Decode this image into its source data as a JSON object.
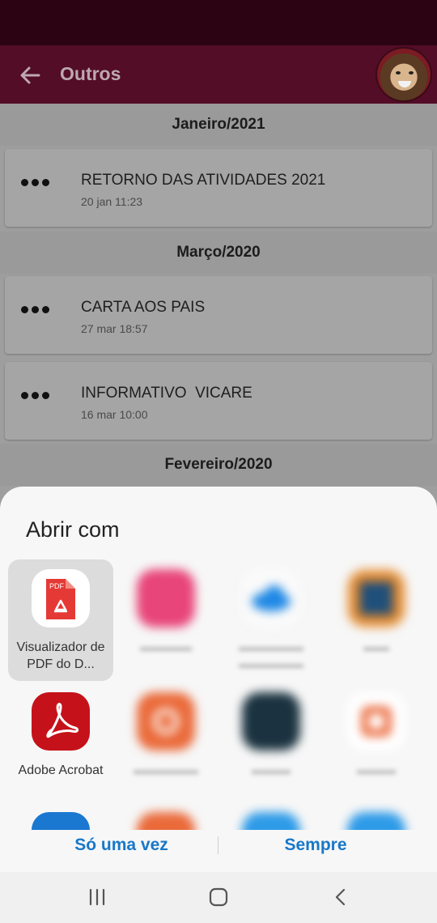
{
  "header": {
    "title": "Outros"
  },
  "list": {
    "sections": [
      {
        "month": "Janeiro/2021",
        "items": [
          {
            "title": "RETORNO DAS ATIVIDADES 2021",
            "date": "20 jan 11:23"
          }
        ]
      },
      {
        "month": "Março/2020",
        "items": [
          {
            "title": "CARTA AOS PAIS",
            "date": "27 mar 18:57"
          },
          {
            "title": "INFORMATIVO  VICARE",
            "date": "16 mar 10:00"
          }
        ]
      },
      {
        "month": "Fevereiro/2020",
        "items": []
      }
    ]
  },
  "sheet": {
    "title": "Abrir com",
    "apps": [
      {
        "label": "Visualizador de PDF do D...",
        "icon": "pdf-viewer-icon",
        "selected": true
      },
      {
        "label": "",
        "icon": "blurred-pink-app-icon"
      },
      {
        "label": "",
        "icon": "cloud-icon"
      },
      {
        "label": "",
        "icon": "blurred-orange-app-icon"
      },
      {
        "label": "Adobe Acrobat",
        "icon": "adobe-acrobat-icon"
      },
      {
        "label": "",
        "icon": "blurred-orange-app-icon"
      },
      {
        "label": "",
        "icon": "blurred-dark-app-icon"
      },
      {
        "label": "",
        "icon": "office-icon"
      }
    ],
    "buttons": {
      "once": "Só uma vez",
      "always": "Sempre"
    }
  },
  "colors": {
    "statusbar": "#2c0313",
    "appbar": "#530d26",
    "accent": "#1878c9",
    "acrobat_red": "#c5121a",
    "pdf_red": "#e53935"
  }
}
